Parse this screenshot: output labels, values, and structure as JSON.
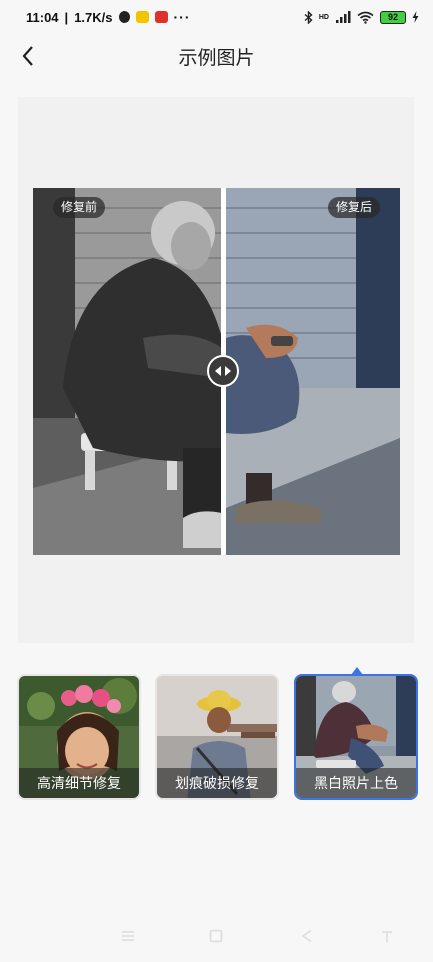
{
  "status_bar": {
    "time": "11:04",
    "speed": "1.7K/s",
    "more": "···",
    "battery": "92",
    "network": "HD"
  },
  "header": {
    "title": "示例图片"
  },
  "preview": {
    "before_label": "修复前",
    "after_label": "修复后"
  },
  "samples": [
    {
      "label": "高清细节修复",
      "selected": false
    },
    {
      "label": "划痕破损修复",
      "selected": false
    },
    {
      "label": "黑白照片上色",
      "selected": true
    }
  ],
  "colors": {
    "accent": "#3b74e6",
    "page_bg": "#f7f7f7"
  },
  "nav_icons": [
    "menu-icon",
    "home-square-icon",
    "back-triangle-icon",
    "recent-apps-icon"
  ]
}
